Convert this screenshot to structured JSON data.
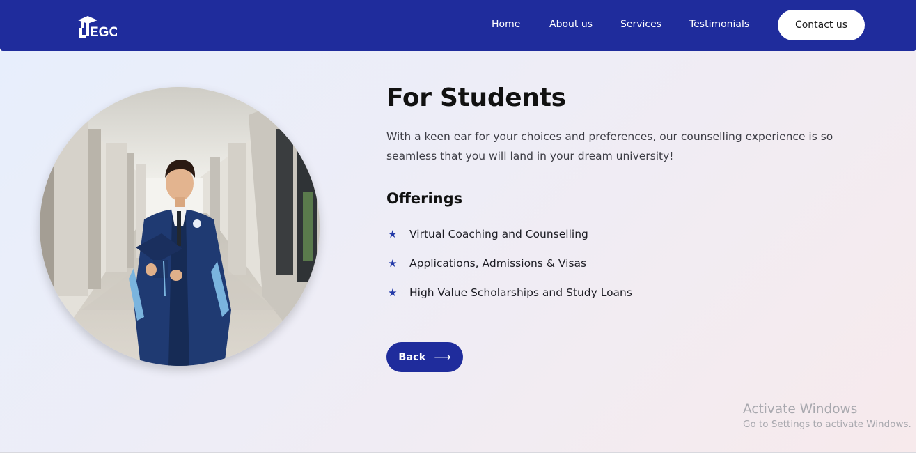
{
  "nav": {
    "home": "Home",
    "about": "About us",
    "services": "Services",
    "testimonials": "Testimonials",
    "contact": "Contact us"
  },
  "logo": {
    "text": "EGC"
  },
  "hero": {
    "title": "For Students",
    "description": "With a keen ear for your choices and preferences, our counselling experience is so seamless that you will land in your dream university!",
    "offerings_heading": "Offerings",
    "offerings": [
      "Virtual Coaching and Counselling",
      "Applications, Admissions & Visas",
      "High Value Scholarships and Study Loans"
    ],
    "back_label": "Back",
    "arrow": "⟶"
  },
  "watermark": {
    "title": "Activate Windows",
    "subtitle": "Go to Settings to activate Windows."
  },
  "colors": {
    "brand": "#1f2c9c",
    "star": "#233aa8"
  }
}
